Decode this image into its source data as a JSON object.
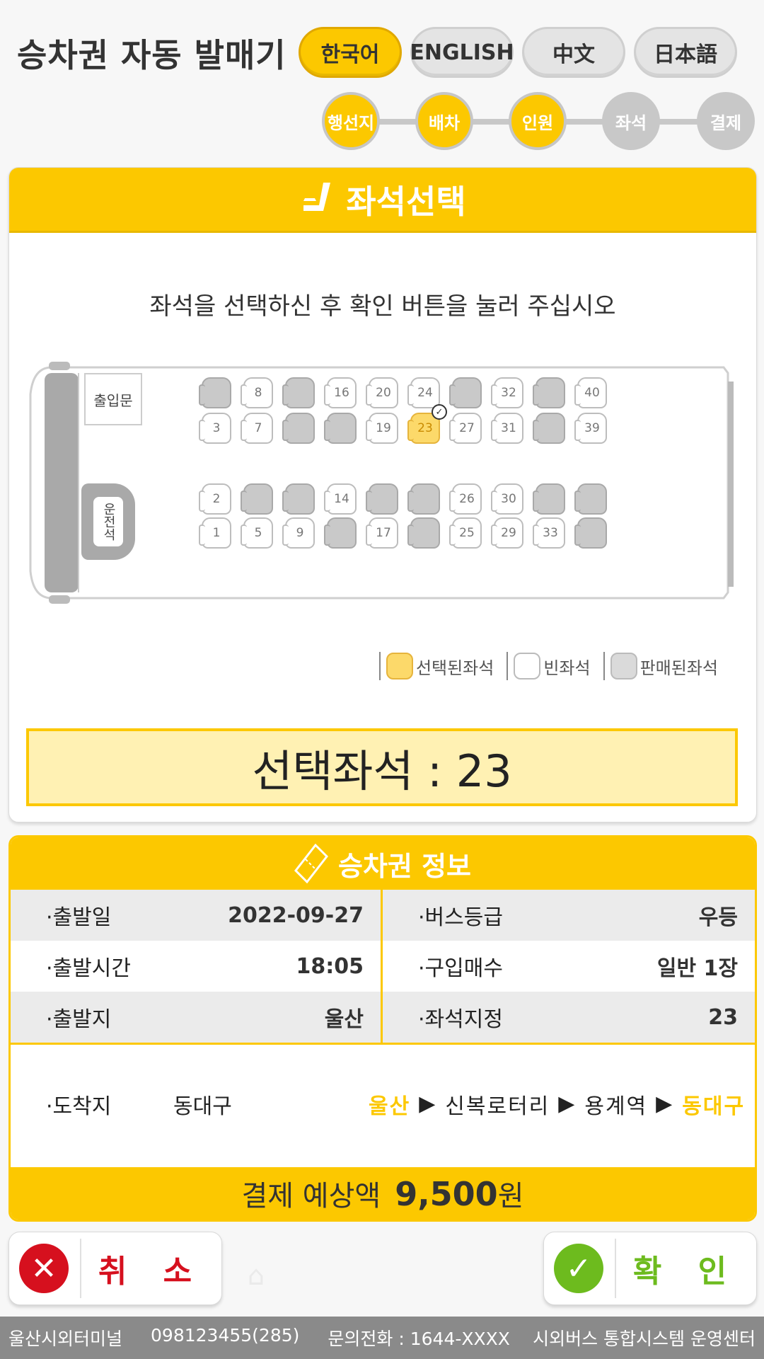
{
  "header": {
    "title": "승차권 자동 발매기",
    "languages": [
      {
        "label": "한국어",
        "active": true
      },
      {
        "label": "ENGLISH",
        "active": false
      },
      {
        "label": "中文",
        "active": false
      },
      {
        "label": "日本語",
        "active": false
      }
    ],
    "steps": [
      {
        "label": "행선지",
        "done": true
      },
      {
        "label": "배차",
        "done": true
      },
      {
        "label": "인원",
        "done": true
      },
      {
        "label": "좌석",
        "done": false
      },
      {
        "label": "결제",
        "done": false
      }
    ]
  },
  "seat_panel": {
    "title": "좌석선택",
    "instruction": "좌석을 선택하신 후 확인 버튼을 눌러 주십시오",
    "door_label": "출입문",
    "driver_label": "운전석",
    "rows": [
      [
        {
          "n": "",
          "state": "sold"
        },
        {
          "n": "8",
          "state": "empty"
        },
        {
          "n": "",
          "state": "sold"
        },
        {
          "n": "16",
          "state": "empty"
        },
        {
          "n": "20",
          "state": "empty"
        },
        {
          "n": "24",
          "state": "empty"
        },
        {
          "n": "",
          "state": "sold"
        },
        {
          "n": "32",
          "state": "empty"
        },
        {
          "n": "",
          "state": "sold"
        },
        {
          "n": "40",
          "state": "empty"
        }
      ],
      [
        {
          "n": "3",
          "state": "empty"
        },
        {
          "n": "7",
          "state": "empty"
        },
        {
          "n": "",
          "state": "sold"
        },
        {
          "n": "",
          "state": "sold"
        },
        {
          "n": "19",
          "state": "empty"
        },
        {
          "n": "23",
          "state": "selected"
        },
        {
          "n": "27",
          "state": "empty"
        },
        {
          "n": "31",
          "state": "empty"
        },
        {
          "n": "",
          "state": "sold"
        },
        {
          "n": "39",
          "state": "empty"
        }
      ],
      [
        {
          "n": "2",
          "state": "empty"
        },
        {
          "n": "",
          "state": "sold"
        },
        {
          "n": "",
          "state": "sold"
        },
        {
          "n": "14",
          "state": "empty"
        },
        {
          "n": "",
          "state": "sold"
        },
        {
          "n": "",
          "state": "sold"
        },
        {
          "n": "26",
          "state": "empty"
        },
        {
          "n": "30",
          "state": "empty"
        },
        {
          "n": "",
          "state": "sold"
        },
        {
          "n": "",
          "state": "sold"
        }
      ],
      [
        {
          "n": "1",
          "state": "empty"
        },
        {
          "n": "5",
          "state": "empty"
        },
        {
          "n": "9",
          "state": "empty"
        },
        {
          "n": "",
          "state": "sold"
        },
        {
          "n": "17",
          "state": "empty"
        },
        {
          "n": "",
          "state": "sold"
        },
        {
          "n": "25",
          "state": "empty"
        },
        {
          "n": "29",
          "state": "empty"
        },
        {
          "n": "33",
          "state": "empty"
        },
        {
          "n": "",
          "state": "sold"
        }
      ]
    ],
    "legend": {
      "selected": "선택된좌석",
      "empty": "빈좌석",
      "sold": "판매된좌석"
    },
    "selected_seat_text": "선택좌석 : 23"
  },
  "ticket": {
    "title": "승차권 정보",
    "rows": [
      {
        "left_label": "·출발일",
        "left_value": "2022-09-27",
        "right_label": "·버스등급",
        "right_value": "우등"
      },
      {
        "left_label": "·출발시간",
        "left_value": "18:05",
        "right_label": "·구입매수",
        "right_value": "일반 1장"
      },
      {
        "left_label": "·출발지",
        "left_value": "울산",
        "right_label": "·좌석지정",
        "right_value": "23"
      }
    ],
    "destination_label": "·도착지",
    "destination_value": "동대구",
    "route": {
      "start": "울산",
      "via1": "신복로터리",
      "via2": "용계역",
      "end": "동대구",
      "arrow": "▶"
    },
    "fare_label": "결제 예상액",
    "fare_amount": "9,500",
    "fare_unit": "원"
  },
  "buttons": {
    "cancel": "취 소",
    "confirm": "확 인"
  },
  "footer": {
    "terminal": "울산시외터미널",
    "terminal_code": "098123455(285)",
    "contact": "문의전화 : 1644-XXXX",
    "operator": "시외버스 통합시스템 운영센터"
  },
  "colors": {
    "accent": "#fcc800",
    "cancel": "#d6101e",
    "confirm": "#6dbb1e"
  }
}
